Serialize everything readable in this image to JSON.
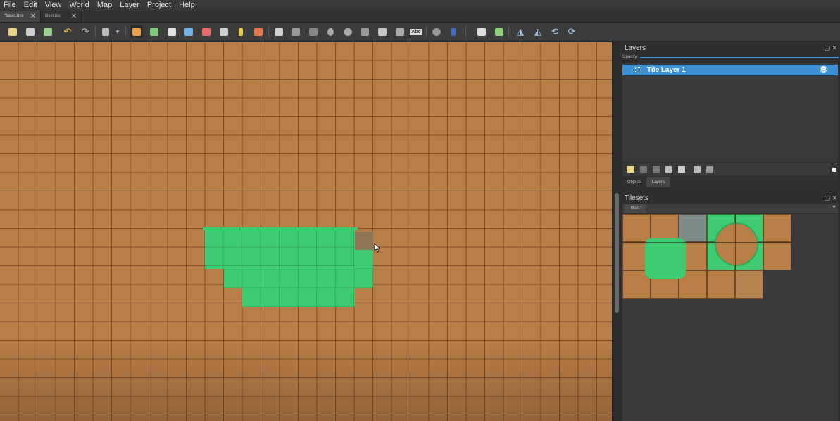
{
  "menu": [
    "File",
    "Edit",
    "View",
    "World",
    "Map",
    "Layer",
    "Project",
    "Help"
  ],
  "tabs": [
    {
      "label": "*basic.tmx",
      "close": "✕"
    },
    {
      "label": "tilset.tsx",
      "close": "✕"
    }
  ],
  "toolbar": {
    "icons": [
      "new-map-icon",
      "open-icon",
      "save-icon",
      "undo-icon",
      "redo-icon",
      "stamp-dropdown-icon",
      "stamp-brush-icon",
      "terrain-brush-icon",
      "bucket-fill-icon",
      "shape-fill-icon",
      "eraser-icon",
      "rect-select-icon",
      "magic-wand-icon",
      "select-same-tile-icon",
      "select-objects-icon",
      "edit-polygons-icon",
      "insert-rectangle-icon",
      "insert-point-icon",
      "insert-ellipse-icon",
      "insert-polygon-icon",
      "insert-tile-icon",
      "insert-template-icon",
      "insert-text-icon",
      "world-tool-icon",
      "move-tool-icon",
      "random-mode-icon",
      "wang-fill-icon",
      "flip-horizontal-icon",
      "flip-vertical-icon",
      "rotate-left-icon",
      "rotate-right-icon"
    ],
    "text_icon_label": "Abc"
  },
  "layers_panel": {
    "title": "Layers",
    "opacity_label": "Opacity:",
    "layer_name": "Tile Layer 1",
    "eye": "👁",
    "subtabs": [
      "Objects",
      "Layers"
    ]
  },
  "tilesets_panel": {
    "title": "Tilesets",
    "tab": "tilset"
  },
  "colors": {
    "dirt": "#b87e48",
    "grass": "#3fcb72",
    "selection": "#3d8fd1"
  }
}
